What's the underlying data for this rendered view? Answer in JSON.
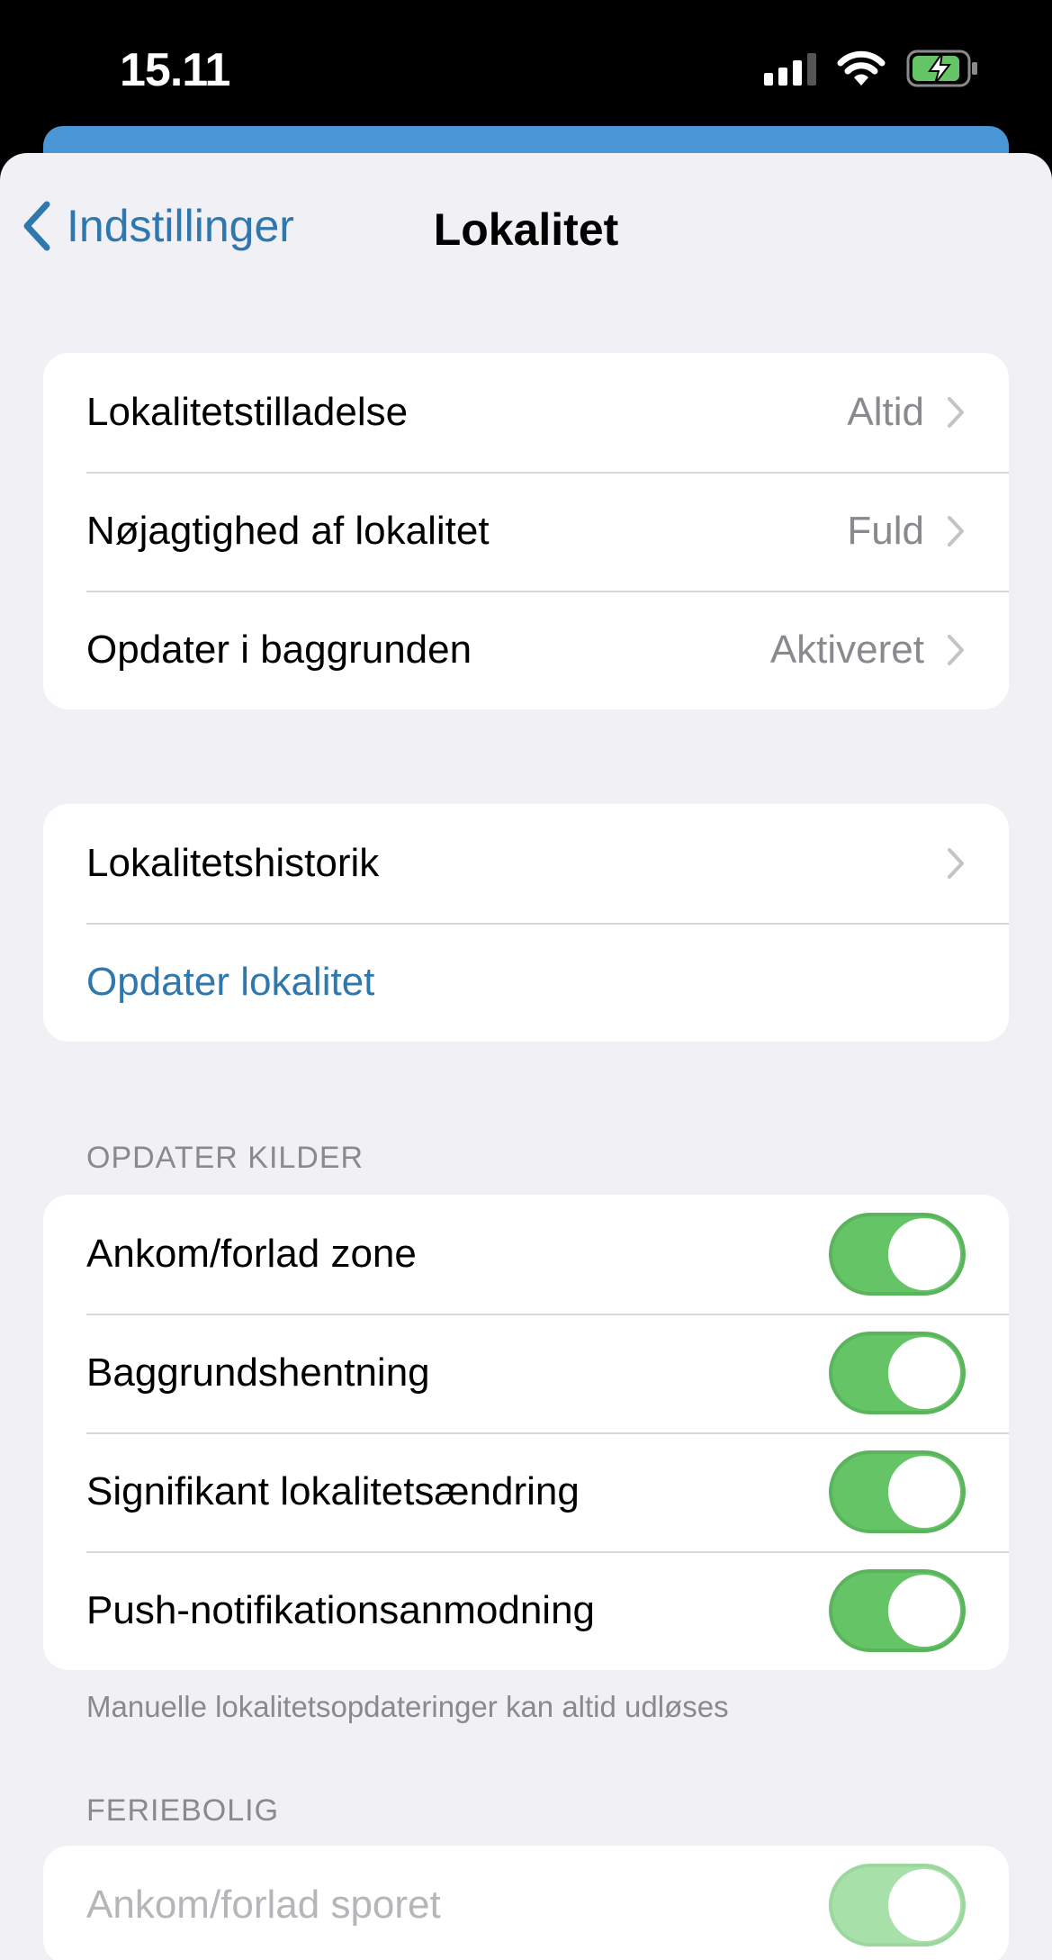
{
  "status_bar": {
    "time": "15.11",
    "signal_icon": "signal-bars-icon",
    "wifi_icon": "wifi-icon",
    "battery_icon": "battery-charging-icon"
  },
  "nav": {
    "back_label": "Indstillinger",
    "title": "Lokalitet"
  },
  "group1": [
    {
      "label": "Lokalitetstilladelse",
      "value": "Altid"
    },
    {
      "label": "Nøjagtighed af lokalitet",
      "value": "Fuld"
    },
    {
      "label": "Opdater i baggrunden",
      "value": "Aktiveret"
    }
  ],
  "group2": {
    "history_label": "Lokalitetshistorik",
    "update_label": "Opdater lokalitet"
  },
  "update_sources": {
    "header": "OPDATER KILDER",
    "items": [
      {
        "label": "Ankom/forlad zone",
        "on": true
      },
      {
        "label": "Baggrundshentning",
        "on": true
      },
      {
        "label": "Signifikant lokalitetsændring",
        "on": true
      },
      {
        "label": "Push-notifikationsanmodning",
        "on": true
      }
    ],
    "footer": "Manuelle lokalitetsopdateringer kan altid udløses"
  },
  "vacation_home": {
    "header": "FERIEBOLIG",
    "items": [
      {
        "label": "Ankom/forlad sporet",
        "on": true,
        "enabled": false
      }
    ]
  },
  "colors": {
    "accent": "#2f78ad",
    "toggle_on": "#65c466",
    "background": "#f0f0f5"
  }
}
